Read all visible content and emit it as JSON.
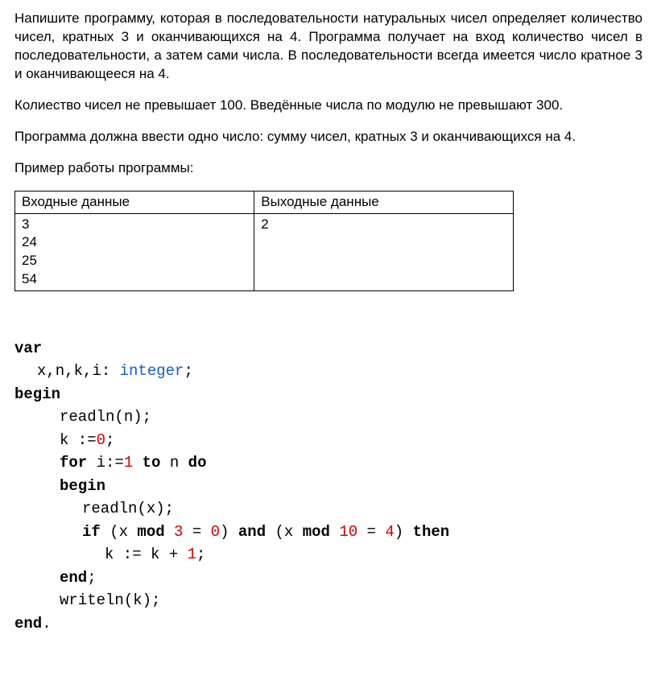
{
  "problem": {
    "p1": "Напишите программу, которая в последовательности натуральных чисел определяет количество чисел, кратных 3 и оканчивающихся на 4. Программа получает на вход количество чисел в последовательности, а затем сами числа. В последовательности всегда имеется число кратное 3 и оканчивающееся на 4.",
    "p2": "Колиество чисел не превышает 100. Введённые числа по модулю не превышают 300.",
    "p3": "Программа должна ввести одно число: сумму чисел, кратных 3 и оканчивающихся на 4.",
    "p4": "Пример работы программы:"
  },
  "table": {
    "header_in": "Входные данные",
    "header_out": "Выходные данные",
    "input_lines": [
      "3",
      "24",
      "25",
      "54"
    ],
    "output": "2"
  },
  "code": {
    "decl_vars": "x,n,k,i: ",
    "type_integer": "integer",
    "readln_n": "readln(n);",
    "k_assign_pre": "k :=",
    "k_assign_zero": "0",
    "for_pre": "for",
    "for_mid1": " i:=",
    "for_one": "1",
    "for_mid2": " ",
    "for_to": "to",
    "for_mid3": " n ",
    "for_do": "do",
    "readln_x": "readln(x);",
    "if_kw": "if",
    "if_mid1": " (x ",
    "mod_kw": "mod",
    "if_three": "3",
    "if_eq1": " = ",
    "if_zero": "0",
    "if_mid2": ") ",
    "and_kw": "and",
    "if_mid3": " (x ",
    "if_ten": "10",
    "if_mid4": " = ",
    "if_four": "4",
    "if_mid5": ") ",
    "then_kw": "then",
    "k_inc_pre": "k := k + ",
    "k_inc_one": "1",
    "writeln_k": "writeln(k);",
    "kw_var": "var",
    "kw_begin": "begin",
    "kw_end_semi": "end",
    "kw_end_dot": "end",
    "semi": ";",
    "dot": "."
  }
}
